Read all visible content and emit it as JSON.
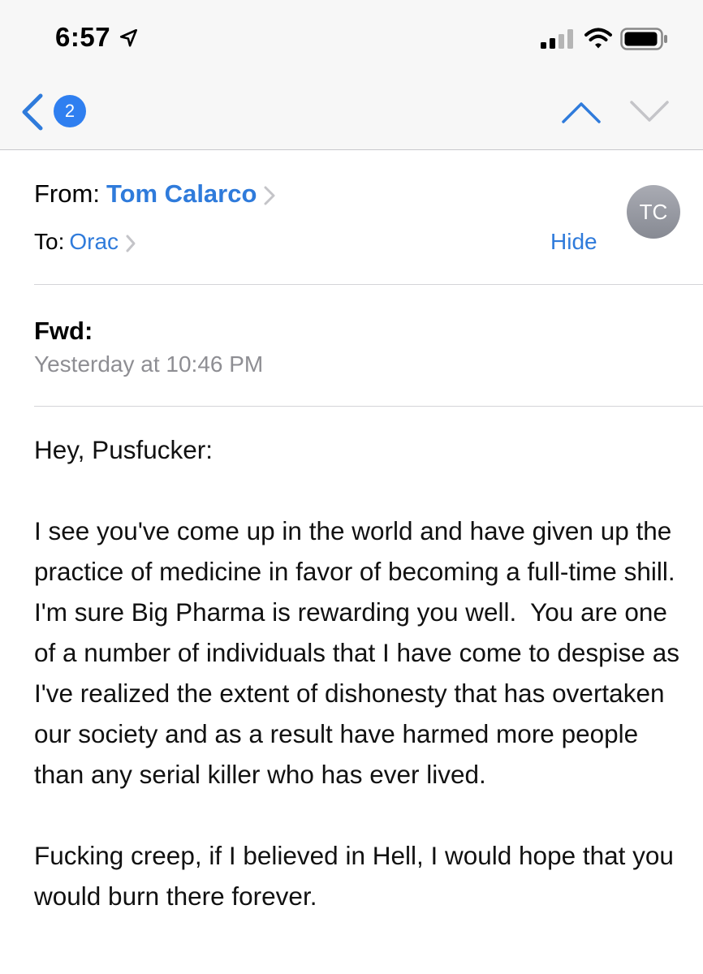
{
  "status_bar": {
    "time": "6:57"
  },
  "nav": {
    "back_badge_count": "2"
  },
  "message": {
    "from_label": "From:",
    "from_name": "Tom Calarco",
    "to_label": "To:",
    "to_name": "Orac",
    "hide_label": "Hide",
    "avatar_initials": "TC",
    "subject": "Fwd:",
    "date": "Yesterday at 10:46 PM",
    "body": {
      "greeting": "Hey, Pusfucker:",
      "paragraph_1": "I see you've come up in the world and have given up the practice of medicine in favor of becoming a full-time shill. I'm sure Big Pharma is rewarding you well.  You are one of a number of individuals that I have come to despise as I've realized the extent of dishonesty that has overtaken our society and as a result have harmed more people than any serial killer who has ever lived.",
      "paragraph_2": "Fucking creep, if I believed in Hell, I would hope that you would burn there forever."
    }
  },
  "colors": {
    "accent": "#2f7bdb",
    "badge": "#2f7ff0",
    "secondary_text": "#8e8e93",
    "avatar": "#9a9ca4",
    "bar_background": "#f7f7f7"
  },
  "icons": [
    "location-arrow-icon",
    "signal-icon",
    "wifi-icon",
    "battery-icon",
    "chevron-left-icon",
    "chevron-up-icon",
    "chevron-down-icon",
    "chevron-right-icon"
  ]
}
